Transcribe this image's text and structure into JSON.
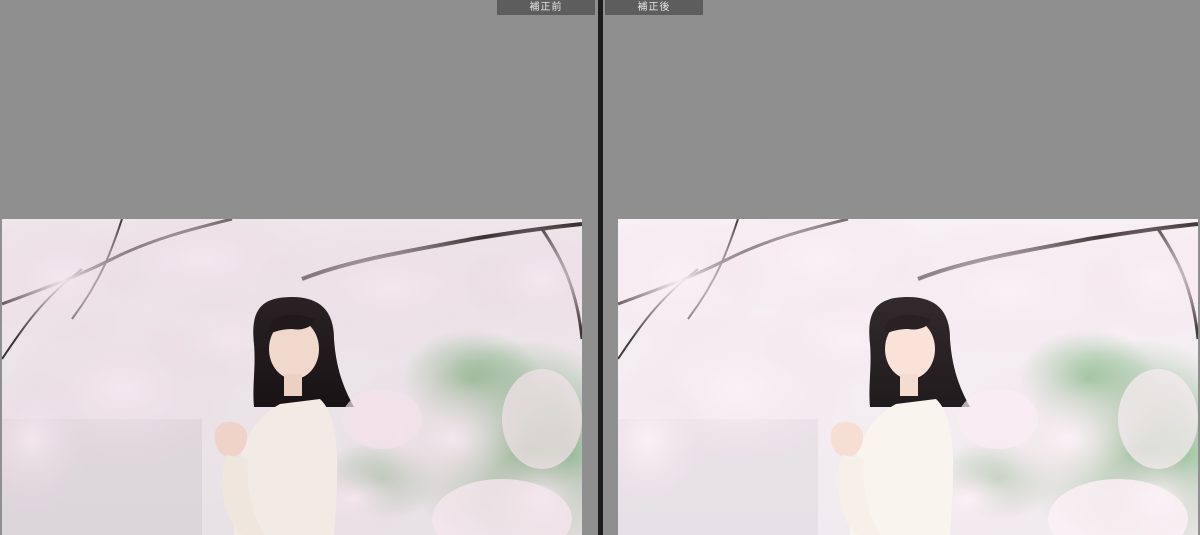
{
  "compare": {
    "before_label": "補正前",
    "after_label": "補正後"
  },
  "colors": {
    "canvas": "#8f8f8f",
    "divider": "#1c1c1c",
    "label_bg": "#5d5d5d",
    "label_text": "#e6e6e6"
  }
}
